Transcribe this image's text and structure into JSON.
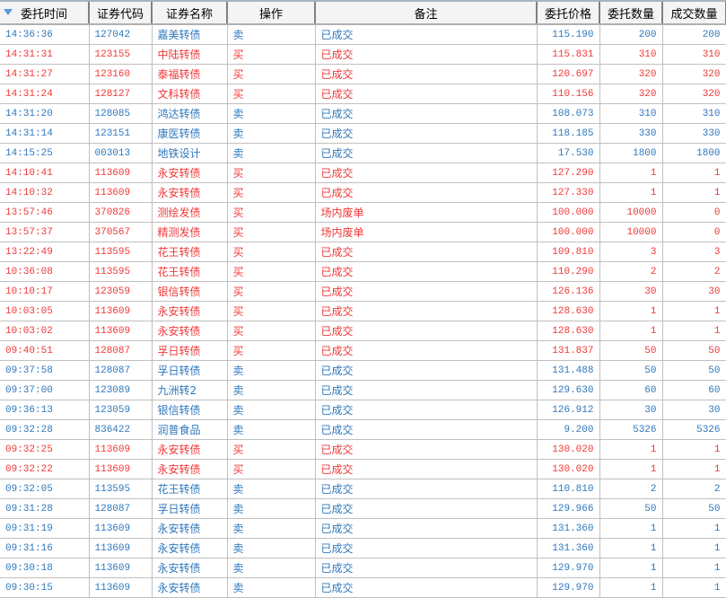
{
  "columns": [
    "委托时间",
    "证券代码",
    "证券名称",
    "操作",
    "备注",
    "委托价格",
    "委托数量",
    "成交数量"
  ],
  "colors": {
    "buy": "#f03838",
    "sell": "#2f78bc"
  },
  "rows": [
    {
      "side": "sell",
      "time": "14:36:36",
      "code": "127042",
      "name": "嘉美转债",
      "action": "卖",
      "remark": "已成交",
      "price": "115.190",
      "qty": "200",
      "filled": "200"
    },
    {
      "side": "buy",
      "time": "14:31:31",
      "code": "123155",
      "name": "中陆转债",
      "action": "买",
      "remark": "已成交",
      "price": "115.831",
      "qty": "310",
      "filled": "310"
    },
    {
      "side": "buy",
      "time": "14:31:27",
      "code": "123160",
      "name": "泰福转债",
      "action": "买",
      "remark": "已成交",
      "price": "120.697",
      "qty": "320",
      "filled": "320"
    },
    {
      "side": "buy",
      "time": "14:31:24",
      "code": "128127",
      "name": "文科转债",
      "action": "买",
      "remark": "已成交",
      "price": "110.156",
      "qty": "320",
      "filled": "320"
    },
    {
      "side": "sell",
      "time": "14:31:20",
      "code": "128085",
      "name": "鸿达转债",
      "action": "卖",
      "remark": "已成交",
      "price": "108.073",
      "qty": "310",
      "filled": "310"
    },
    {
      "side": "sell",
      "time": "14:31:14",
      "code": "123151",
      "name": "康医转债",
      "action": "卖",
      "remark": "已成交",
      "price": "118.185",
      "qty": "330",
      "filled": "330"
    },
    {
      "side": "sell",
      "time": "14:15:25",
      "code": "003013",
      "name": "地铁设计",
      "action": "卖",
      "remark": "已成交",
      "price": "17.530",
      "qty": "1800",
      "filled": "1800"
    },
    {
      "side": "buy",
      "time": "14:10:41",
      "code": "113609",
      "name": "永安转债",
      "action": "买",
      "remark": "已成交",
      "price": "127.290",
      "qty": "1",
      "filled": "1"
    },
    {
      "side": "buy",
      "time": "14:10:32",
      "code": "113609",
      "name": "永安转债",
      "action": "买",
      "remark": "已成交",
      "price": "127.330",
      "qty": "1",
      "filled": "1"
    },
    {
      "side": "buy",
      "time": "13:57:46",
      "code": "370826",
      "name": "测绘发债",
      "action": "买",
      "remark": "场内废单",
      "price": "100.000",
      "qty": "10000",
      "filled": "0"
    },
    {
      "side": "buy",
      "time": "13:57:37",
      "code": "370567",
      "name": "精测发债",
      "action": "买",
      "remark": "场内废单",
      "price": "100.000",
      "qty": "10000",
      "filled": "0"
    },
    {
      "side": "buy",
      "time": "13:22:49",
      "code": "113595",
      "name": "花王转债",
      "action": "买",
      "remark": "已成交",
      "price": "109.810",
      "qty": "3",
      "filled": "3"
    },
    {
      "side": "buy",
      "time": "10:36:08",
      "code": "113595",
      "name": "花王转债",
      "action": "买",
      "remark": "已成交",
      "price": "110.290",
      "qty": "2",
      "filled": "2"
    },
    {
      "side": "buy",
      "time": "10:10:17",
      "code": "123059",
      "name": "银信转债",
      "action": "买",
      "remark": "已成交",
      "price": "126.136",
      "qty": "30",
      "filled": "30"
    },
    {
      "side": "buy",
      "time": "10:03:05",
      "code": "113609",
      "name": "永安转债",
      "action": "买",
      "remark": "已成交",
      "price": "128.630",
      "qty": "1",
      "filled": "1"
    },
    {
      "side": "buy",
      "time": "10:03:02",
      "code": "113609",
      "name": "永安转债",
      "action": "买",
      "remark": "已成交",
      "price": "128.630",
      "qty": "1",
      "filled": "1"
    },
    {
      "side": "buy",
      "time": "09:40:51",
      "code": "128087",
      "name": "孚日转债",
      "action": "买",
      "remark": "已成交",
      "price": "131.837",
      "qty": "50",
      "filled": "50"
    },
    {
      "side": "sell",
      "time": "09:37:58",
      "code": "128087",
      "name": "孚日转债",
      "action": "卖",
      "remark": "已成交",
      "price": "131.488",
      "qty": "50",
      "filled": "50"
    },
    {
      "side": "sell",
      "time": "09:37:00",
      "code": "123089",
      "name": "九洲转2",
      "action": "卖",
      "remark": "已成交",
      "price": "129.630",
      "qty": "60",
      "filled": "60"
    },
    {
      "side": "sell",
      "time": "09:36:13",
      "code": "123059",
      "name": "银信转债",
      "action": "卖",
      "remark": "已成交",
      "price": "126.912",
      "qty": "30",
      "filled": "30"
    },
    {
      "side": "sell",
      "time": "09:32:28",
      "code": "836422",
      "name": "润普食品",
      "action": "卖",
      "remark": "已成交",
      "price": "9.200",
      "qty": "5326",
      "filled": "5326"
    },
    {
      "side": "buy",
      "time": "09:32:25",
      "code": "113609",
      "name": "永安转债",
      "action": "买",
      "remark": "已成交",
      "price": "130.020",
      "qty": "1",
      "filled": "1"
    },
    {
      "side": "buy",
      "time": "09:32:22",
      "code": "113609",
      "name": "永安转债",
      "action": "买",
      "remark": "已成交",
      "price": "130.020",
      "qty": "1",
      "filled": "1"
    },
    {
      "side": "sell",
      "time": "09:32:05",
      "code": "113595",
      "name": "花王转债",
      "action": "卖",
      "remark": "已成交",
      "price": "110.810",
      "qty": "2",
      "filled": "2"
    },
    {
      "side": "sell",
      "time": "09:31:28",
      "code": "128087",
      "name": "孚日转债",
      "action": "卖",
      "remark": "已成交",
      "price": "129.966",
      "qty": "50",
      "filled": "50"
    },
    {
      "side": "sell",
      "time": "09:31:19",
      "code": "113609",
      "name": "永安转债",
      "action": "卖",
      "remark": "已成交",
      "price": "131.360",
      "qty": "1",
      "filled": "1"
    },
    {
      "side": "sell",
      "time": "09:31:16",
      "code": "113609",
      "name": "永安转债",
      "action": "卖",
      "remark": "已成交",
      "price": "131.360",
      "qty": "1",
      "filled": "1"
    },
    {
      "side": "sell",
      "time": "09:30:18",
      "code": "113609",
      "name": "永安转债",
      "action": "卖",
      "remark": "已成交",
      "price": "129.970",
      "qty": "1",
      "filled": "1"
    },
    {
      "side": "sell",
      "time": "09:30:15",
      "code": "113609",
      "name": "永安转债",
      "action": "卖",
      "remark": "已成交",
      "price": "129.970",
      "qty": "1",
      "filled": "1"
    }
  ]
}
